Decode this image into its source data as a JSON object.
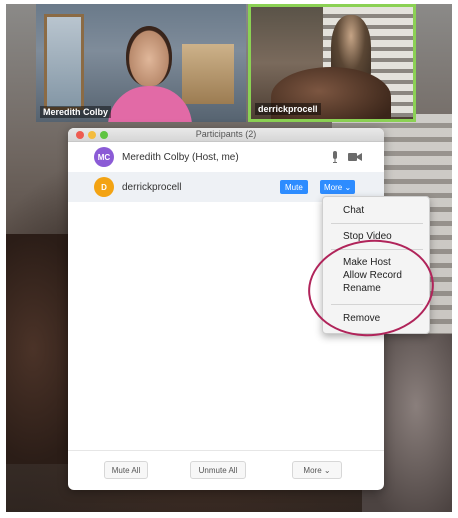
{
  "thumbnails": [
    {
      "name": "Meredith Colby"
    },
    {
      "name": "derrickprocell"
    }
  ],
  "panel": {
    "title": "Participants (2)"
  },
  "participants": [
    {
      "initials": "MC",
      "name": "Meredith Colby (Host, me)",
      "avatar_color": "#8b5bd6",
      "mic_icon": "microphone-icon",
      "cam_icon": "video-camera-icon"
    },
    {
      "initials": "D",
      "name": "derrickprocell",
      "avatar_color": "#f3a313",
      "mute_label": "Mute",
      "more_label": "More ⌄"
    }
  ],
  "menu": {
    "items": [
      "Chat",
      "Stop Video",
      "Make Host",
      "Allow Record",
      "Rename",
      "Remove"
    ]
  },
  "footer": {
    "mute_all": "Mute All",
    "unmute_all": "Unmute All",
    "more": "More ⌄"
  },
  "colors": {
    "accent": "#2d8cff",
    "active_speaker_border": "#8bd154",
    "annotation": "#b0245a"
  }
}
